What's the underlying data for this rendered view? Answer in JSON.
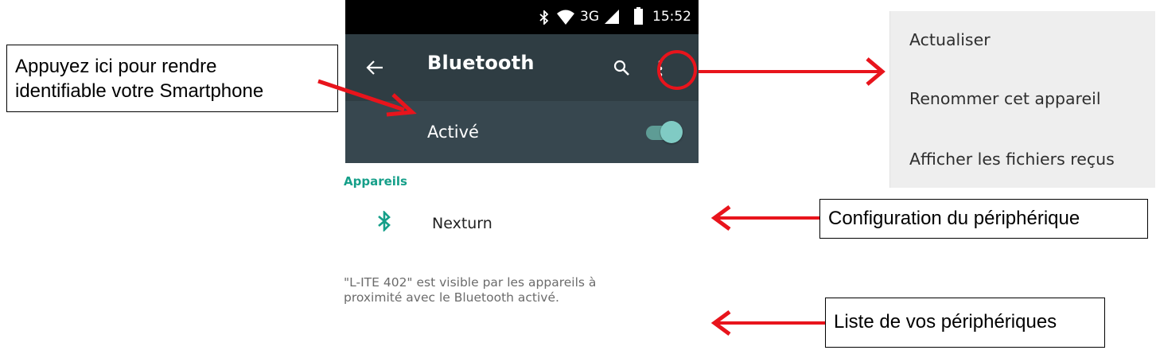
{
  "status_bar": {
    "network": "3G",
    "time": "15:52",
    "icons": [
      "bluetooth-icon",
      "wifi-icon",
      "signal-icon",
      "battery-icon"
    ]
  },
  "toolbar": {
    "title": "Bluetooth",
    "back_icon": "arrow-back-icon",
    "search_icon": "search-icon",
    "more_icon": "more-vert-icon"
  },
  "switch_bar": {
    "label": "Activé",
    "state": "on"
  },
  "devices": {
    "section_title": "Appareils",
    "items": [
      {
        "name": "Nexturn",
        "icon": "bluetooth-icon"
      }
    ]
  },
  "visibility_text": {
    "line1": "\"L-ITE 402\" est visible par les appareils à",
    "line2": "proximité avec le Bluetooth activé."
  },
  "overflow_menu": {
    "items": [
      "Actualiser",
      "Renommer cet appareil",
      "Afficher les fichiers reçus"
    ]
  },
  "callouts": {
    "visibility": {
      "line1": "Appuyez ici pour rendre",
      "line2": "identifiable votre Smartphone"
    },
    "configuration": "Configuration du périphérique",
    "list": "Liste de vos périphériques"
  },
  "colors": {
    "status_bar": "#000000",
    "toolbar": "#2f3d43",
    "switch_bar": "#37474f",
    "accent": "#159f89",
    "toggle_thumb": "#80cbc4",
    "annotation_red": "#e8141c",
    "menu_bg": "#eeeeee"
  }
}
